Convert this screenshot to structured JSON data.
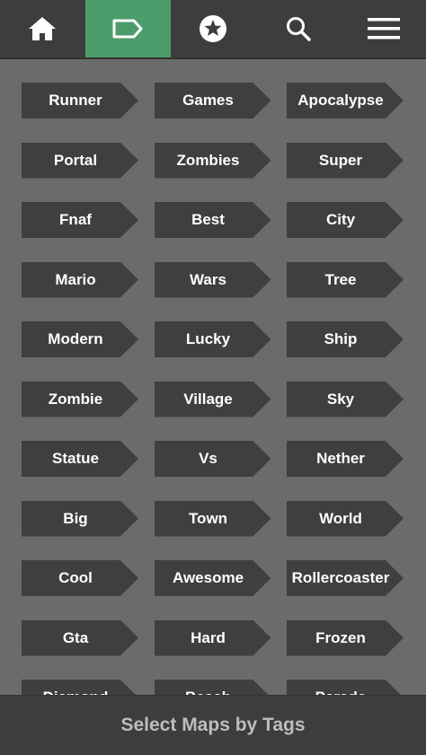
{
  "toolbar": {
    "items": [
      {
        "icon": "home-icon",
        "active": false
      },
      {
        "icon": "tag-icon",
        "active": true
      },
      {
        "icon": "star-icon",
        "active": false
      },
      {
        "icon": "search-icon",
        "active": false
      },
      {
        "icon": "menu-icon",
        "active": false
      }
    ],
    "colors": {
      "bar": "#3d3d3d",
      "active": "#4c9b6a",
      "icon": "#ffffff"
    }
  },
  "tags": [
    "Runner",
    "Games",
    "Apocalypse",
    "Portal",
    "Zombies",
    "Super",
    "Fnaf",
    "Best",
    "City",
    "Mario",
    "Wars",
    "Tree",
    "Modern",
    "Lucky",
    "Ship",
    "Zombie",
    "Village",
    "Sky",
    "Statue",
    "Vs",
    "Nether",
    "Big",
    "Town",
    "World",
    "Cool",
    "Awesome",
    "Rollercoaster",
    "Gta",
    "Hard",
    "Frozen",
    "Diamond",
    "Beach",
    "Parade"
  ],
  "footer": {
    "label": "Select Maps by Tags"
  }
}
